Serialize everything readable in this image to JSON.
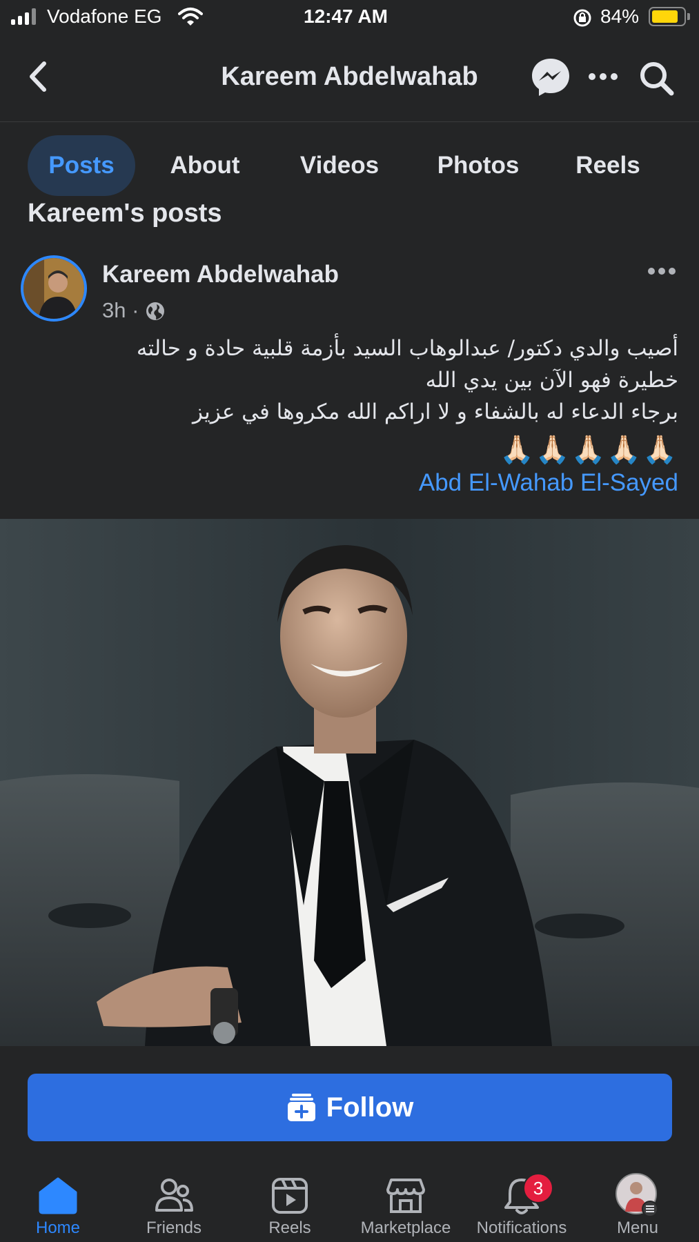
{
  "status_bar": {
    "carrier": "Vodafone EG",
    "time": "12:47 AM",
    "battery": "84%",
    "battery_level": 0.84
  },
  "header": {
    "title": "Kareem Abdelwahab",
    "icons": [
      "back-icon",
      "messenger-icon",
      "more-icon",
      "search-icon"
    ]
  },
  "tabs": [
    {
      "label": "Posts",
      "active": true
    },
    {
      "label": "About",
      "active": false
    },
    {
      "label": "Videos",
      "active": false
    },
    {
      "label": "Photos",
      "active": false
    },
    {
      "label": "Reels",
      "active": false
    }
  ],
  "section_title": "Kareem's posts",
  "post": {
    "author": "Kareem Abdelwahab",
    "time": "3h",
    "audience_icon": "globe-icon",
    "text_lines": [
      "أصيب والدي دكتور/ عبدالوهاب السيد بأزمة قلبية حادة و حالته",
      "خطيرة فهو الآن بين يدي الله",
      "برجاء الدعاء له بالشفاء و لا اراكم الله مكروها في عزيز"
    ],
    "emojis": "🙏🏻🙏🏻🙏🏻🙏🏻🙏🏻",
    "mention": "Abd El-Wahab El-Sayed"
  },
  "follow_button": {
    "label": "Follow",
    "icon": "follow-page-icon"
  },
  "bottom_nav": [
    {
      "label": "Home",
      "icon": "home-icon",
      "active": true
    },
    {
      "label": "Friends",
      "icon": "friends-icon",
      "active": false
    },
    {
      "label": "Reels",
      "icon": "reels-icon",
      "active": false
    },
    {
      "label": "Marketplace",
      "icon": "marketplace-icon",
      "active": false
    },
    {
      "label": "Notifications",
      "icon": "bell-icon",
      "active": false,
      "badge": "3"
    },
    {
      "label": "Menu",
      "icon": "profile-menu-icon",
      "active": false
    }
  ],
  "colors": {
    "accent": "#2d88ff",
    "background": "#242526",
    "follow": "#2d6ee0",
    "badge": "#e41e3f"
  }
}
